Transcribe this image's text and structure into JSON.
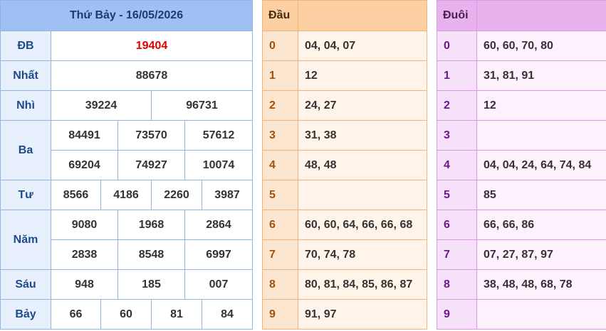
{
  "results": {
    "title": "Thứ Bảy - 16/05/2026",
    "db": {
      "label": "ĐB",
      "value": "19404"
    },
    "nhat": {
      "label": "Nhất",
      "value": "88678"
    },
    "nhi": {
      "label": "Nhì",
      "values": [
        "39224",
        "96731"
      ]
    },
    "ba": {
      "label": "Ba",
      "values": [
        "84491",
        "73570",
        "57612",
        "69204",
        "74927",
        "10074"
      ]
    },
    "tu": {
      "label": "Tư",
      "values": [
        "8566",
        "4186",
        "2260",
        "3987"
      ]
    },
    "nam": {
      "label": "Năm",
      "values": [
        "9080",
        "1968",
        "2864",
        "2838",
        "8548",
        "6997"
      ]
    },
    "sau": {
      "label": "Sáu",
      "values": [
        "948",
        "185",
        "007"
      ]
    },
    "bay": {
      "label": "Bảy",
      "values": [
        "66",
        "60",
        "81",
        "84"
      ]
    }
  },
  "dau": {
    "header": "Đầu",
    "rows": [
      {
        "key": "0",
        "value": "04, 04, 07"
      },
      {
        "key": "1",
        "value": "12"
      },
      {
        "key": "2",
        "value": "24, 27"
      },
      {
        "key": "3",
        "value": "31, 38"
      },
      {
        "key": "4",
        "value": "48, 48"
      },
      {
        "key": "5",
        "value": ""
      },
      {
        "key": "6",
        "value": "60, 60, 64, 66, 66, 68"
      },
      {
        "key": "7",
        "value": "70, 74, 78"
      },
      {
        "key": "8",
        "value": "80, 81, 84, 85, 86, 87"
      },
      {
        "key": "9",
        "value": "91, 97"
      }
    ]
  },
  "duoi": {
    "header": "Đuôi",
    "rows": [
      {
        "key": "0",
        "value": "60, 60, 70, 80"
      },
      {
        "key": "1",
        "value": "31, 81, 91"
      },
      {
        "key": "2",
        "value": "12"
      },
      {
        "key": "3",
        "value": ""
      },
      {
        "key": "4",
        "value": "04, 04, 24, 64, 74, 84"
      },
      {
        "key": "5",
        "value": "85"
      },
      {
        "key": "6",
        "value": "66, 66, 86"
      },
      {
        "key": "7",
        "value": "07, 27, 87, 97"
      },
      {
        "key": "8",
        "value": "38, 48, 48, 68, 78"
      },
      {
        "key": "9",
        "value": ""
      }
    ]
  }
}
